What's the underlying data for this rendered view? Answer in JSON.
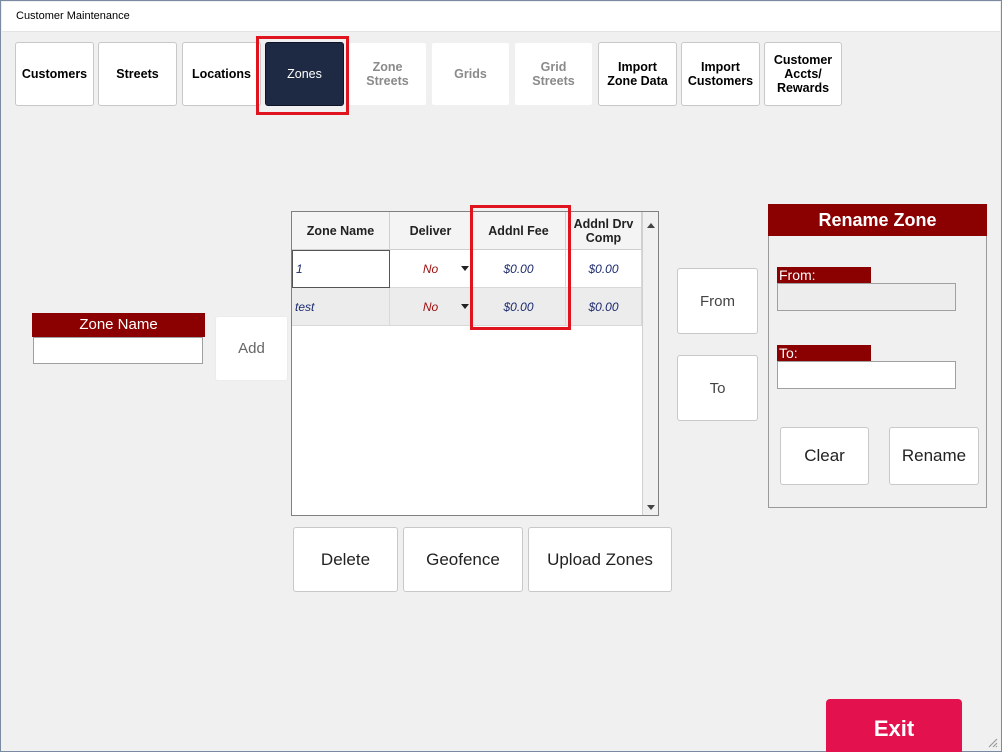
{
  "window": {
    "title": "Customer Maintenance"
  },
  "tabs": [
    {
      "label": "Customers",
      "state": "enabled"
    },
    {
      "label": "Streets",
      "state": "enabled"
    },
    {
      "label": "Locations",
      "state": "enabled"
    },
    {
      "label": "Zones",
      "state": "active"
    },
    {
      "label": "Zone\nStreets",
      "state": "disabled"
    },
    {
      "label": "Grids",
      "state": "disabled"
    },
    {
      "label": "Grid\nStreets",
      "state": "disabled"
    },
    {
      "label": "Import\nZone Data",
      "state": "enabled"
    },
    {
      "label": "Import\nCustomers",
      "state": "enabled"
    },
    {
      "label": "Customer\nAccts/\nRewards",
      "state": "enabled"
    }
  ],
  "zone_name": {
    "label": "Zone Name",
    "value": "",
    "add_label": "Add"
  },
  "grid": {
    "columns": [
      "Zone Name",
      "Deliver",
      "Addnl Fee",
      "Addnl Drv\nComp"
    ],
    "rows": [
      {
        "zone_name": "1",
        "deliver": "No",
        "addnl_fee": "$0.00",
        "addnl_drv_comp": "$0.00"
      },
      {
        "zone_name": "test",
        "deliver": "No",
        "addnl_fee": "$0.00",
        "addnl_drv_comp": "$0.00"
      }
    ]
  },
  "actions": {
    "delete": "Delete",
    "geofence": "Geofence",
    "upload_zones": "Upload Zones"
  },
  "from_to": {
    "from": "From",
    "to": "To"
  },
  "rename_zone": {
    "title": "Rename Zone",
    "from_label": "From:",
    "from_value": "",
    "to_label": "To:",
    "to_value": "",
    "clear": "Clear",
    "rename": "Rename"
  },
  "exit_label": "Exit",
  "colors": {
    "label_bar": "#8b0000",
    "active_tab": "#1e2a44",
    "exit": "#e3124f",
    "highlight": "#e0141e"
  }
}
